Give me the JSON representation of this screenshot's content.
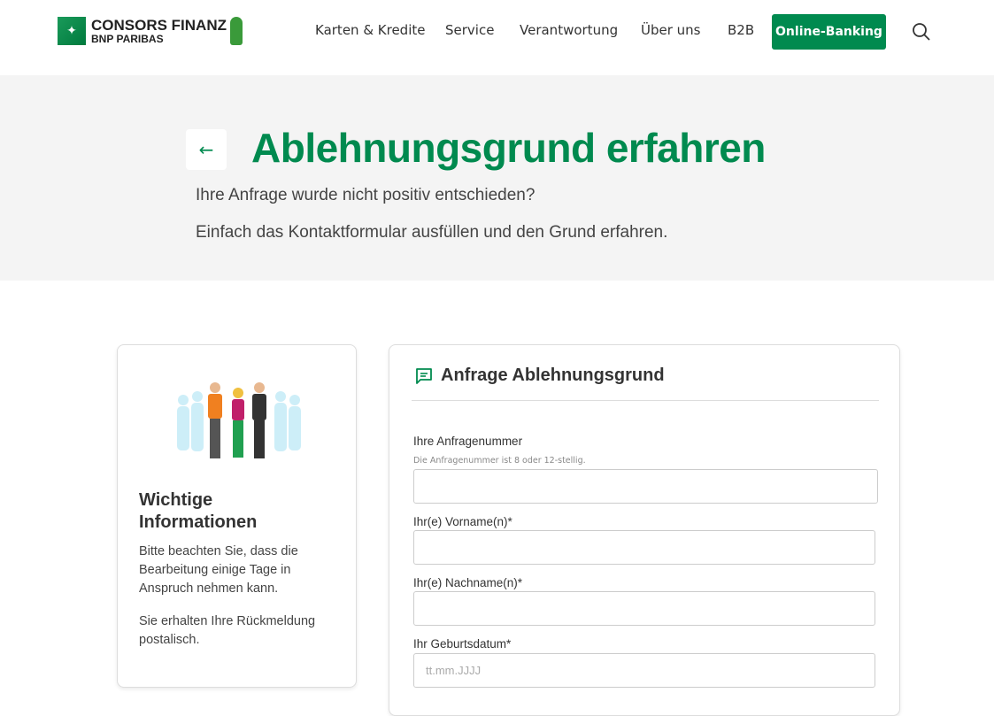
{
  "header": {
    "logo": {
      "line1": "CONSORS FINANZ",
      "line2": "BNP PARIBAS"
    },
    "nav": [
      "Karten & Kredite",
      "Service",
      "Verantwortung",
      "Über uns",
      "B2B"
    ],
    "online_banking": "Online-Banking",
    "colors": {
      "brand": "#008a4f"
    }
  },
  "hero": {
    "title": "Ablehnungsgrund erfahren",
    "line1": "Ihre Anfrage wurde nicht positiv entschieden?",
    "line2": "Einfach das Kontaktformular ausfüllen und den Grund erfahren."
  },
  "info": {
    "title": "Wichtige Informationen",
    "p1": "Bitte beachten Sie, dass die Bearbeitung einige Tage in Anspruch nehmen kann.",
    "p2": "Sie erhalten Ihre Rückmeldung postalisch."
  },
  "form": {
    "title": "Anfrage Ablehnungsgrund",
    "request_label": "Ihre Anfragenummer",
    "request_hint": "Die Anfragenummer ist 8 oder 12-stellig.",
    "first_label": "Ihr(e) Vorname(n)*",
    "last_label": "Ihr(e) Nachname(n)*",
    "dob_label": "Ihr Geburtsdatum*",
    "dob_placeholder": "tt.mm.JJJJ"
  }
}
